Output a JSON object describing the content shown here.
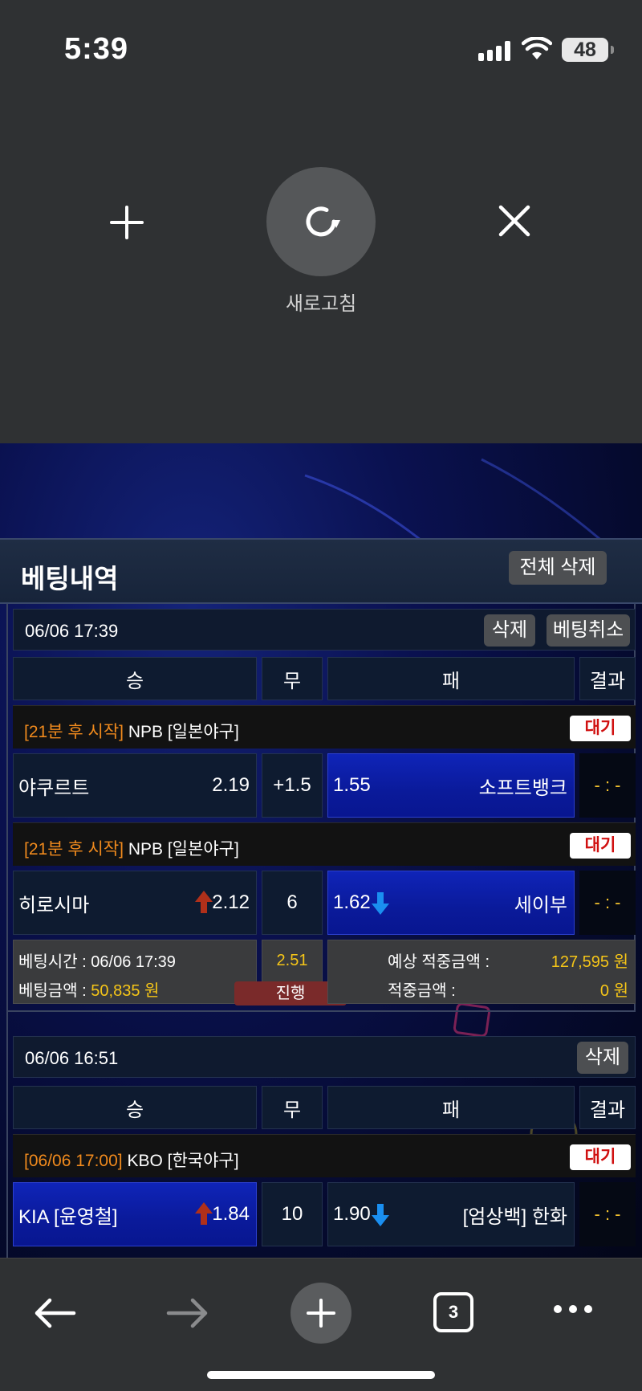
{
  "status": {
    "time": "5:39",
    "battery": "48"
  },
  "refresh": {
    "label": "새로고침"
  },
  "history": {
    "title": "베팅내역",
    "delete_all": "전체 삭제",
    "columns": {
      "win": "승",
      "draw": "무",
      "lose": "패",
      "result": "결과"
    },
    "cards": [
      {
        "date": "06/06 17:39",
        "delete": "삭제",
        "cancel": "베팅취소",
        "games": [
          {
            "start": "[21분 후 시작]",
            "league": "NPB [일본야구]",
            "status": "대기",
            "home": "야쿠르트",
            "home_odds": "2.19",
            "mid": "+1.5",
            "away_odds": "1.55",
            "away": "소프트뱅크",
            "score": "- : -"
          },
          {
            "start": "[21분 후 시작]",
            "league": "NPB [일본야구]",
            "status": "대기",
            "home": "히로시마",
            "home_odds": "2.12",
            "mid": "6",
            "away_odds": "1.62",
            "away": "세이부",
            "score": "- : -"
          }
        ],
        "summary": {
          "bet_time_label": "베팅시간 : 06/06 17:39",
          "bet_amount_label": "베팅금액 :",
          "bet_amount": "50,835 원",
          "total_odds": "2.51",
          "progress": "진행",
          "expected_label": "예상 적중금액 :",
          "expected_value": "127,595 원",
          "hit_label": "적중금액 :",
          "hit_value": "0 원"
        }
      },
      {
        "date": "06/06 16:51",
        "delete": "삭제",
        "games": [
          {
            "start": "[06/06 17:00]",
            "league": "KBO [한국야구]",
            "status": "대기",
            "home": "KIA [윤영철]",
            "home_odds": "1.84",
            "mid": "10",
            "away_odds": "1.90",
            "away": "[엄상백] 한화",
            "score": "- : -"
          }
        ]
      }
    ]
  },
  "bottom": {
    "tab_count": "3"
  }
}
